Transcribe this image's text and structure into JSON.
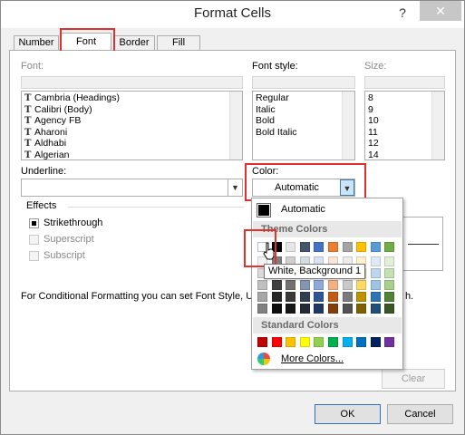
{
  "window": {
    "title": "Format Cells",
    "help_label": "?",
    "close_label": "✕"
  },
  "tabs": [
    {
      "label": "Number"
    },
    {
      "label": "Font"
    },
    {
      "label": "Border"
    },
    {
      "label": "Fill"
    }
  ],
  "font": {
    "label": "Font:",
    "value": "",
    "items": [
      "Cambria (Headings)",
      "Calibri (Body)",
      "Agency FB",
      "Aharoni",
      "Aldhabi",
      "Algerian"
    ],
    "icon_glyph": "T"
  },
  "font_style": {
    "label": "Font style:",
    "value": "",
    "items": [
      "Regular",
      "Italic",
      "Bold",
      "Bold Italic"
    ]
  },
  "size": {
    "label": "Size:",
    "value": "",
    "items": [
      "8",
      "9",
      "10",
      "11",
      "12",
      "14"
    ]
  },
  "underline": {
    "label": "Underline:",
    "value": "",
    "arrow": "▼"
  },
  "color": {
    "label": "Color:",
    "value": "Automatic",
    "arrow": "▼"
  },
  "effects": {
    "label": "Effects",
    "strikethrough": {
      "label": "Strikethrough",
      "checked": true
    },
    "superscript": {
      "label": "Superscript",
      "checked": false
    },
    "subscript": {
      "label": "Subscript",
      "checked": false
    }
  },
  "note": "For Conditional Formatting you can set Font Style, U",
  "note_tail": "h.",
  "palette": {
    "automatic_label": "Automatic",
    "automatic_color": "#000000",
    "theme_header": "Theme Colors",
    "standard_header": "Standard Colors",
    "more_colors_label": "More Colors...",
    "theme_top": [
      "#ffffff",
      "#000000",
      "#e7e6e6",
      "#44546a",
      "#4472c4",
      "#ed7d31",
      "#a5a5a5",
      "#ffc000",
      "#5b9bd5",
      "#70ad47"
    ],
    "theme_columns": [
      [
        "#f2f2f2",
        "#d9d9d9",
        "#bfbfbf",
        "#a6a6a6",
        "#808080"
      ],
      [
        "#7f7f7f",
        "#595959",
        "#404040",
        "#262626",
        "#0d0d0d"
      ],
      [
        "#d0cece",
        "#aeabab",
        "#757171",
        "#3a3838",
        "#171616"
      ],
      [
        "#d6dce4",
        "#acb9ca",
        "#8496b0",
        "#333f4f",
        "#222a35"
      ],
      [
        "#d9e2f3",
        "#b4c6e7",
        "#8eaadb",
        "#2f5597",
        "#1f3864"
      ],
      [
        "#fbe5d5",
        "#f7caac",
        "#f4b183",
        "#c55a11",
        "#843c0b"
      ],
      [
        "#ededed",
        "#dbdbdb",
        "#c9c9c9",
        "#7b7b7b",
        "#525252"
      ],
      [
        "#fff2cc",
        "#ffe699",
        "#ffd966",
        "#bf9000",
        "#7f6000"
      ],
      [
        "#deebf6",
        "#bdd7ee",
        "#9dc3e6",
        "#2e75b5",
        "#1f4e79"
      ],
      [
        "#e2efd9",
        "#c5e0b3",
        "#a8d08d",
        "#538135",
        "#375623"
      ]
    ],
    "standard": [
      "#c00000",
      "#ff0000",
      "#ffc000",
      "#ffff00",
      "#92d050",
      "#00b050",
      "#00b0f0",
      "#0070c0",
      "#002060",
      "#7030a0"
    ]
  },
  "tooltip": "White, Background 1",
  "buttons": {
    "clear": "Clear",
    "ok": "OK",
    "cancel": "Cancel"
  }
}
